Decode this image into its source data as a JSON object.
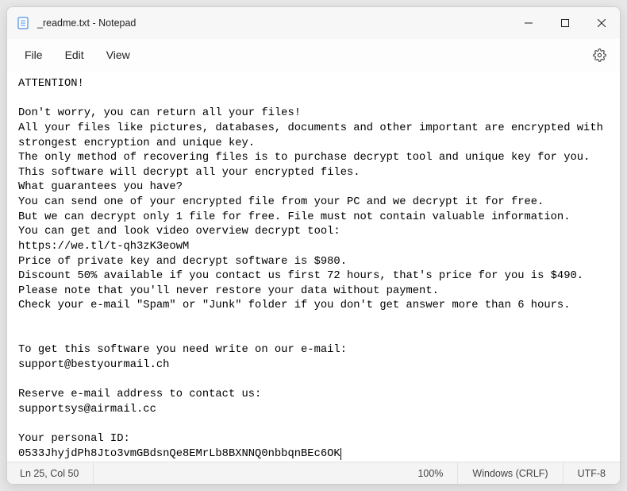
{
  "titlebar": {
    "title": "_readme.txt - Notepad"
  },
  "menu": {
    "file": "File",
    "edit": "Edit",
    "view": "View"
  },
  "content": {
    "l1": "ATTENTION!",
    "l2": "",
    "l3": "Don't worry, you can return all your files!",
    "l4": "All your files like pictures, databases, documents and other important are encrypted with strongest encryption and unique key.",
    "l5": "The only method of recovering files is to purchase decrypt tool and unique key for you.",
    "l6": "This software will decrypt all your encrypted files.",
    "l7": "What guarantees you have?",
    "l8": "You can send one of your encrypted file from your PC and we decrypt it for free.",
    "l9": "But we can decrypt only 1 file for free. File must not contain valuable information.",
    "l10": "You can get and look video overview decrypt tool:",
    "l11": "https://we.tl/t-qh3zK3eowM",
    "l12": "Price of private key and decrypt software is $980.",
    "l13": "Discount 50% available if you contact us first 72 hours, that's price for you is $490.",
    "l14": "Please note that you'll never restore your data without payment.",
    "l15": "Check your e-mail \"Spam\" or \"Junk\" folder if you don't get answer more than 6 hours.",
    "l16": "",
    "l17": "",
    "l18": "To get this software you need write on our e-mail:",
    "l19": "support@bestyourmail.ch",
    "l20": "",
    "l21": "Reserve e-mail address to contact us:",
    "l22": "supportsys@airmail.cc",
    "l23": "",
    "l24": "Your personal ID:",
    "l25": "0533JhyjdPh8Jto3vmGBdsnQe8EMrLb8BXNNQ0nbbqnBEc6OK"
  },
  "status": {
    "pos": "Ln 25, Col 50",
    "zoom": "100%",
    "eol": "Windows (CRLF)",
    "enc": "UTF-8"
  }
}
